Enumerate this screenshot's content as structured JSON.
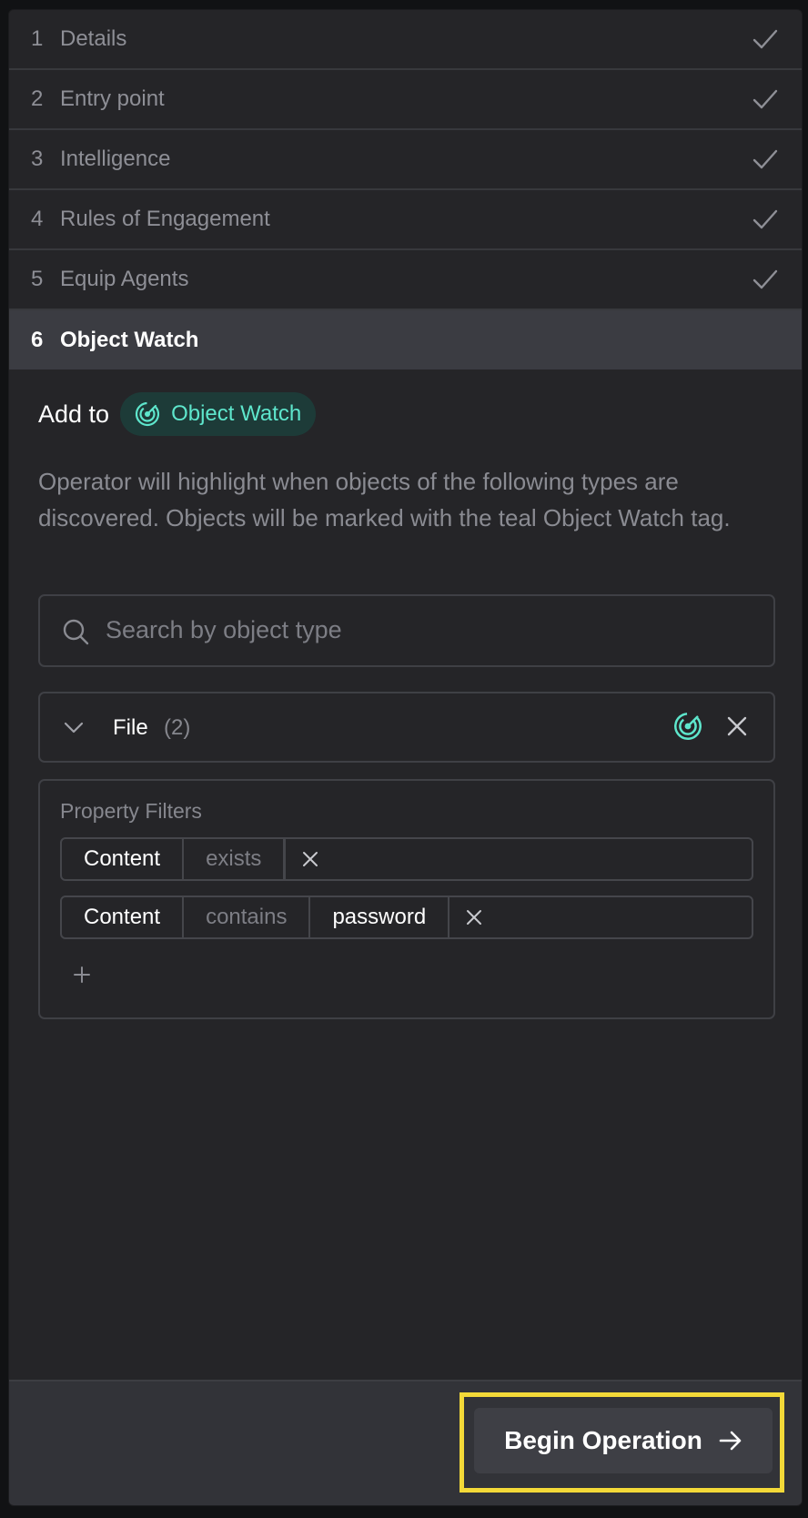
{
  "steps": [
    {
      "number": "1",
      "label": "Details",
      "completed": true
    },
    {
      "number": "2",
      "label": "Entry point",
      "completed": true
    },
    {
      "number": "3",
      "label": "Intelligence",
      "completed": true
    },
    {
      "number": "4",
      "label": "Rules of Engagement",
      "completed": true
    },
    {
      "number": "5",
      "label": "Equip Agents",
      "completed": true
    },
    {
      "number": "6",
      "label": "Object Watch",
      "completed": false,
      "active": true
    }
  ],
  "object_watch": {
    "add_to_label": "Add to",
    "tag_label": "Object Watch",
    "tag_icon": "radar-icon",
    "tag_color": "#5ee6cc",
    "description": "Operator will highlight when objects of the following types are discovered. Objects will be marked with the teal Object Watch tag.",
    "search_placeholder": "Search by object type",
    "object_type": {
      "name": "File",
      "count": "(2)"
    },
    "property_filters": {
      "title": "Property Filters",
      "rows": [
        {
          "key": "Content",
          "operator": "exists",
          "value": ""
        },
        {
          "key": "Content",
          "operator": "contains",
          "value": "password"
        }
      ],
      "add_icon": "plus-icon"
    }
  },
  "footer": {
    "begin_button_label": "Begin Operation",
    "begin_button_icon": "arrow-right-icon",
    "highlight_color": "#f3d938"
  }
}
